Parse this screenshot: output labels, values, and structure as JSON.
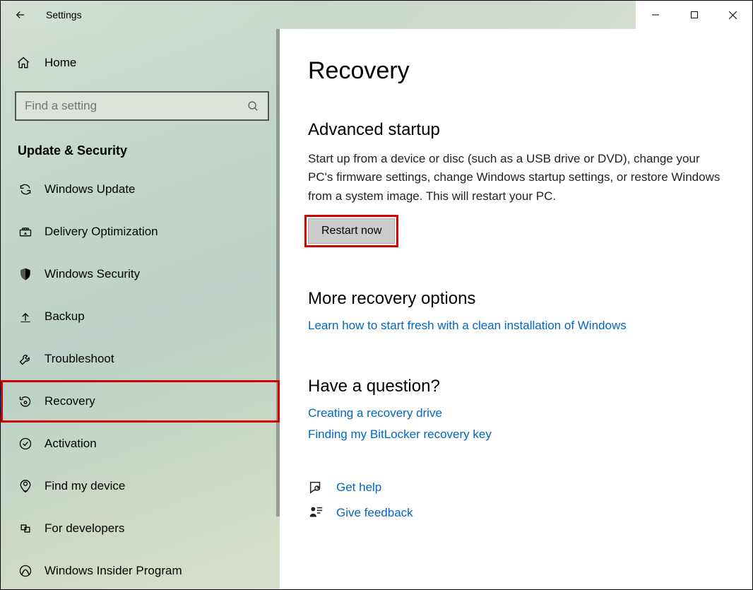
{
  "window": {
    "title": "Settings"
  },
  "sidebar": {
    "home_label": "Home",
    "search_placeholder": "Find a setting",
    "section_title": "Update & Security",
    "items": [
      {
        "label": "Windows Update",
        "icon": "refresh",
        "selected": false
      },
      {
        "label": "Delivery Optimization",
        "icon": "delivery",
        "selected": false
      },
      {
        "label": "Windows Security",
        "icon": "shield",
        "selected": false
      },
      {
        "label": "Backup",
        "icon": "backup",
        "selected": false
      },
      {
        "label": "Troubleshoot",
        "icon": "wrench",
        "selected": false
      },
      {
        "label": "Recovery",
        "icon": "recovery",
        "selected": true,
        "highlighted": true
      },
      {
        "label": "Activation",
        "icon": "check-circle",
        "selected": false
      },
      {
        "label": "Find my device",
        "icon": "location",
        "selected": false
      },
      {
        "label": "For developers",
        "icon": "developers",
        "selected": false
      },
      {
        "label": "Windows Insider Program",
        "icon": "insider",
        "selected": false
      }
    ]
  },
  "content": {
    "page_title": "Recovery",
    "advanced": {
      "heading": "Advanced startup",
      "body": "Start up from a device or disc (such as a USB drive or DVD), change your PC's firmware settings, change Windows startup settings, or restore Windows from a system image. This will restart your PC.",
      "button": "Restart now"
    },
    "more": {
      "heading": "More recovery options",
      "link": "Learn how to start fresh with a clean installation of Windows"
    },
    "question": {
      "heading": "Have a question?",
      "links": [
        "Creating a recovery drive",
        "Finding my BitLocker recovery key"
      ]
    },
    "footer": {
      "get_help": "Get help",
      "feedback": "Give feedback"
    }
  }
}
